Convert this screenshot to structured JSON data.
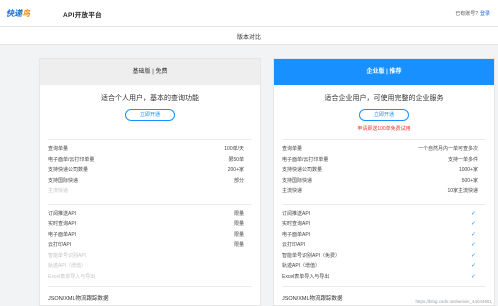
{
  "header": {
    "logo_main": "快递",
    "logo_accent": "鸟",
    "platform": "API开放平台",
    "account_prompt": "已有账号?",
    "login": "登录"
  },
  "title": "版本对比",
  "cards": {
    "basic": {
      "head": "基础版 | 免费",
      "desc": "适合个人用户，基本的查询功能",
      "button": "立即开通",
      "promo": "",
      "rows1": [
        {
          "label": "查询单量",
          "value": "100单/天",
          "disabled": false
        },
        {
          "label": "电子面单/云打印单量",
          "value": "限50单",
          "disabled": false
        },
        {
          "label": "支持快递公司数量",
          "value": "200+家",
          "disabled": false
        },
        {
          "label": "支持国际快递",
          "value": "部分",
          "disabled": false
        },
        {
          "label": "主流快递",
          "value": "",
          "disabled": true
        }
      ],
      "rows2": [
        {
          "label": "订阅推送API",
          "value": "限量",
          "disabled": false
        },
        {
          "label": "实时查询API",
          "value": "限量",
          "disabled": false
        },
        {
          "label": "电子面单API",
          "value": "限量",
          "disabled": false
        },
        {
          "label": "云打印API",
          "value": "限量",
          "disabled": false
        },
        {
          "label": "智能单号识别API",
          "value": "",
          "disabled": true
        },
        {
          "label": "轨迹API（增值）",
          "value": "",
          "disabled": true
        },
        {
          "label": "Excel表单导入与导出",
          "value": "",
          "disabled": true
        }
      ],
      "last": "JSON/XML物流跟踪数据"
    },
    "enterprise": {
      "head": "企业版 | 推荐",
      "desc": "适合企业用户，可使用完整的企业服务",
      "button": "立即开通",
      "promo": "申请即送100单免费试用",
      "rows1": [
        {
          "label": "查询单量",
          "value": "一个自然月内一单可查多次"
        },
        {
          "label": "电子面单/云打印单量",
          "value": "支持一单多件"
        },
        {
          "label": "支持快递公司数量",
          "value": "1000+家"
        },
        {
          "label": "支持国际快递",
          "value": "500+家"
        },
        {
          "label": "主流快递",
          "value": "10家主流快递"
        }
      ],
      "rows2": [
        {
          "label": "订阅推送API",
          "check": "✓"
        },
        {
          "label": "实时查询API",
          "check": "✓"
        },
        {
          "label": "电子面单API",
          "check": "✓"
        },
        {
          "label": "云打印API",
          "check": "✓"
        },
        {
          "label": "智能单号识别API（免费）",
          "check": "✓"
        },
        {
          "label": "轨迹API（增值）",
          "check": "✓"
        },
        {
          "label": "Excel表单导入与导出",
          "check": "✓"
        }
      ],
      "last": "JSON/XML物流跟踪数据"
    }
  },
  "watermark": "https://blog.csdn.net/weixin_44044951",
  "colors": {
    "accent": "#1890ff",
    "promo": "#e53935",
    "logo": "#1d6fd1",
    "logo_accent": "#f08c00"
  }
}
